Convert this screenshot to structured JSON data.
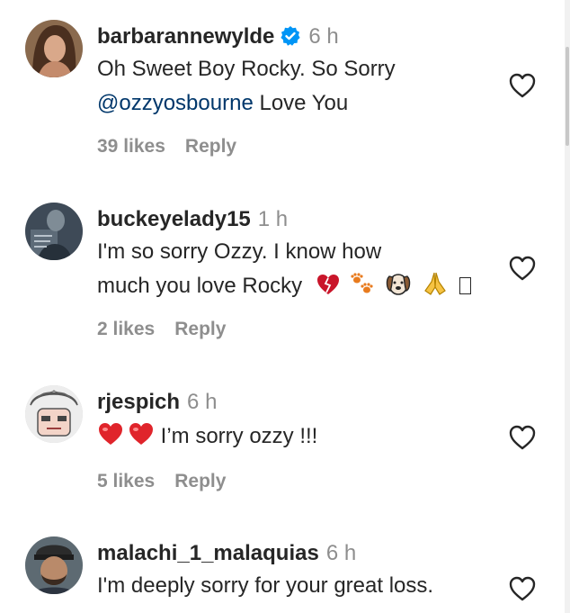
{
  "comments": [
    {
      "username": "barbarannewylde",
      "verified": true,
      "time": "6 h",
      "text_line1": "Oh Sweet Boy Rocky. So Sorry",
      "mention": "@ozzyosbourne",
      "text_after_mention": " Love You",
      "likes": "39 likes",
      "reply": "Reply"
    },
    {
      "username": "buckeyelady15",
      "time": "1 h",
      "text_line1": "I'm so sorry Ozzy. I know how",
      "text_line2": "much you love Rocky",
      "emojis": [
        "broken-heart-icon",
        "paw-prints-icon",
        "dog-face-icon",
        "folded-hands-icon",
        "missing-glyph-box"
      ],
      "likes": "2 likes",
      "reply": "Reply"
    },
    {
      "username": "rjespich",
      "time": "6 h",
      "text": " I’m sorry ozzy !!!",
      "emojis": [
        "red-heart-icon",
        "red-heart-icon"
      ],
      "likes": "5 likes",
      "reply": "Reply"
    },
    {
      "username": "malachi_1_malaquias",
      "time": "6 h",
      "text": "I'm deeply sorry for your great loss."
    }
  ],
  "colors": {
    "text": "#262626",
    "secondary": "#8e8e8e",
    "mention": "#00376b",
    "verified": "#0095f6",
    "heart_emoji": "#e0242b"
  }
}
